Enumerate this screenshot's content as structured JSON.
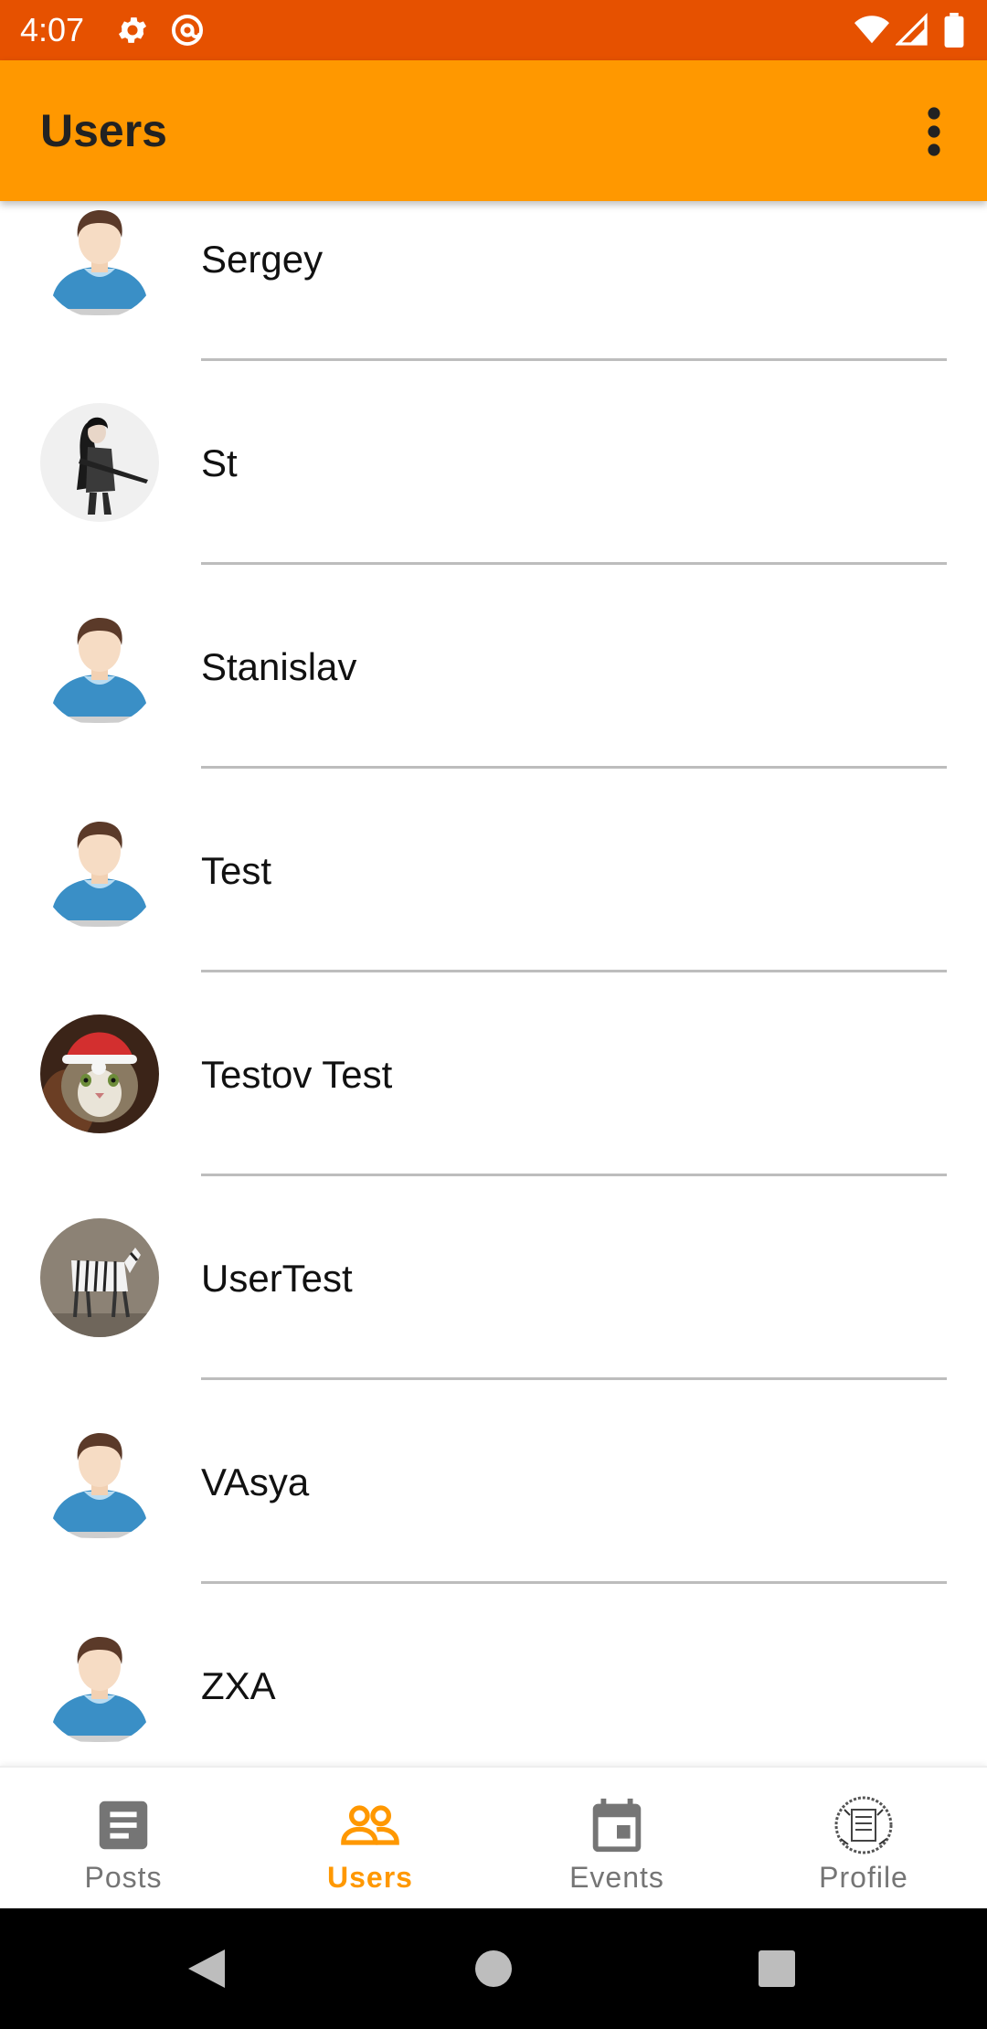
{
  "status_bar": {
    "time": "4:07",
    "icons": [
      "settings-gear-icon",
      "at-sign-icon",
      "wifi-icon",
      "cellular-signal-icon",
      "battery-icon"
    ]
  },
  "app_bar": {
    "title": "Users",
    "menu_icon": "more-vert-icon"
  },
  "users": [
    {
      "name": "Sergey",
      "avatar": "default-person-avatar"
    },
    {
      "name": "St",
      "avatar": "anime-girl-photo-avatar"
    },
    {
      "name": "Stanislav",
      "avatar": "default-person-avatar"
    },
    {
      "name": "Test",
      "avatar": "default-person-avatar"
    },
    {
      "name": "Testov Test",
      "avatar": "cat-in-santa-hat-photo-avatar"
    },
    {
      "name": "UserTest",
      "avatar": "zebra-photo-avatar"
    },
    {
      "name": "VAsya",
      "avatar": "default-person-avatar"
    },
    {
      "name": "ZXA",
      "avatar": "default-person-avatar"
    }
  ],
  "bottom_nav": {
    "items": [
      {
        "label": "Posts",
        "icon": "article-icon",
        "active": false
      },
      {
        "label": "Users",
        "icon": "people-icon",
        "active": true
      },
      {
        "label": "Events",
        "icon": "calendar-icon",
        "active": false
      },
      {
        "label": "Profile",
        "icon": "profile-stamp-avatar",
        "active": false
      }
    ]
  },
  "system_nav": {
    "icons": [
      "back-triangle-icon",
      "home-circle-icon",
      "recents-square-icon"
    ]
  },
  "colors": {
    "status_bar": "#E65100",
    "app_bar": "#FF9800",
    "active_tab": "#FF9800",
    "inactive_tab": "#757575"
  }
}
